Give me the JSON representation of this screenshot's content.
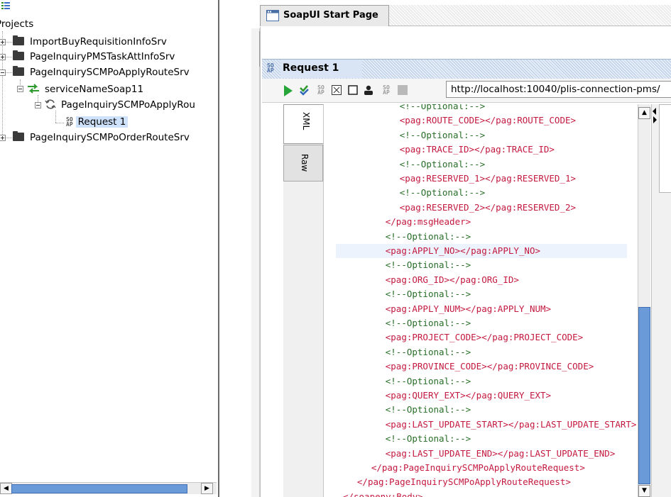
{
  "navigator": {
    "root_label": "Projects",
    "projects": [
      {
        "label": "ImportBuyRequisitionInfoSrv",
        "expanded": false
      },
      {
        "label": "PageInquiryPMSTaskAttInfoSrv",
        "expanded": false
      },
      {
        "label": "PageInquirySCMPoApplyRouteSrv",
        "expanded": true
      },
      {
        "label": "PageInquirySCMPoOrderRouteSrv",
        "expanded": false
      }
    ],
    "interface_label": "serviceNameSoap11",
    "operation_label": "PageInquirySCMPoApplyRou",
    "request_label": "Request 1"
  },
  "start_page": {
    "title": "SoapUI Start Page"
  },
  "request": {
    "title": "Request 1",
    "endpoint": "http://localhost:10040/plis-connection-pms/",
    "tabs": [
      "XML",
      "Raw"
    ]
  },
  "editor": {
    "lines": [
      {
        "indent": 9,
        "text": "<!--Optional:-->",
        "kind": "cmt"
      },
      {
        "indent": 9,
        "text": "<pag:ROUTE_CODE></pag:ROUTE_CODE>",
        "kind": "tag"
      },
      {
        "indent": 9,
        "text": "<!--Optional:-->",
        "kind": "cmt"
      },
      {
        "indent": 9,
        "text": "<pag:TRACE_ID></pag:TRACE_ID>",
        "kind": "tag"
      },
      {
        "indent": 9,
        "text": "<!--Optional:-->",
        "kind": "cmt"
      },
      {
        "indent": 9,
        "text": "<pag:RESERVED_1></pag:RESERVED_1>",
        "kind": "tag"
      },
      {
        "indent": 9,
        "text": "<!--Optional:-->",
        "kind": "cmt"
      },
      {
        "indent": 9,
        "text": "<pag:RESERVED_2></pag:RESERVED_2>",
        "kind": "tag"
      },
      {
        "indent": 7,
        "text": "</pag:msgHeader>",
        "kind": "tag"
      },
      {
        "indent": 7,
        "text": "<!--Optional:-->",
        "kind": "cmt"
      },
      {
        "indent": 7,
        "text": "<pag:APPLY_NO></pag:APPLY_NO>",
        "kind": "tag",
        "highlight": true
      },
      {
        "indent": 7,
        "text": "<!--Optional:-->",
        "kind": "cmt"
      },
      {
        "indent": 7,
        "text": "<pag:ORG_ID></pag:ORG_ID>",
        "kind": "tag"
      },
      {
        "indent": 7,
        "text": "<!--Optional:-->",
        "kind": "cmt"
      },
      {
        "indent": 7,
        "text": "<pag:APPLY_NUM></pag:APPLY_NUM>",
        "kind": "tag"
      },
      {
        "indent": 7,
        "text": "<!--Optional:-->",
        "kind": "cmt"
      },
      {
        "indent": 7,
        "text": "<pag:PROJECT_CODE></pag:PROJECT_CODE>",
        "kind": "tag"
      },
      {
        "indent": 7,
        "text": "<!--Optional:-->",
        "kind": "cmt"
      },
      {
        "indent": 7,
        "text": "<pag:PROVINCE_CODE></pag:PROVINCE_CODE>",
        "kind": "tag"
      },
      {
        "indent": 7,
        "text": "<!--Optional:-->",
        "kind": "cmt"
      },
      {
        "indent": 7,
        "text": "<pag:QUERY_EXT></pag:QUERY_EXT>",
        "kind": "tag"
      },
      {
        "indent": 7,
        "text": "<!--Optional:-->",
        "kind": "cmt"
      },
      {
        "indent": 7,
        "text": "<pag:LAST_UPDATE_START></pag:LAST_UPDATE_START>",
        "kind": "tag"
      },
      {
        "indent": 7,
        "text": "<!--Optional:-->",
        "kind": "cmt"
      },
      {
        "indent": 7,
        "text": "<pag:LAST_UPDATE_END></pag:LAST_UPDATE_END>",
        "kind": "tag"
      },
      {
        "indent": 5,
        "text": "</pag:PageInquirySCMPoApplyRouteRequest>",
        "kind": "tag"
      },
      {
        "indent": 3,
        "text": "</pag:PageInquirySCMPoApplyRouteRequest>",
        "kind": "tag"
      },
      {
        "indent": 1,
        "text": "</soapenv:Body>",
        "kind": "tag"
      }
    ]
  },
  "colors": {
    "tag": "#c4193f",
    "comment": "#276e27",
    "selection": "#cfe2fb",
    "scroll_thumb": "#6a9ad8"
  }
}
